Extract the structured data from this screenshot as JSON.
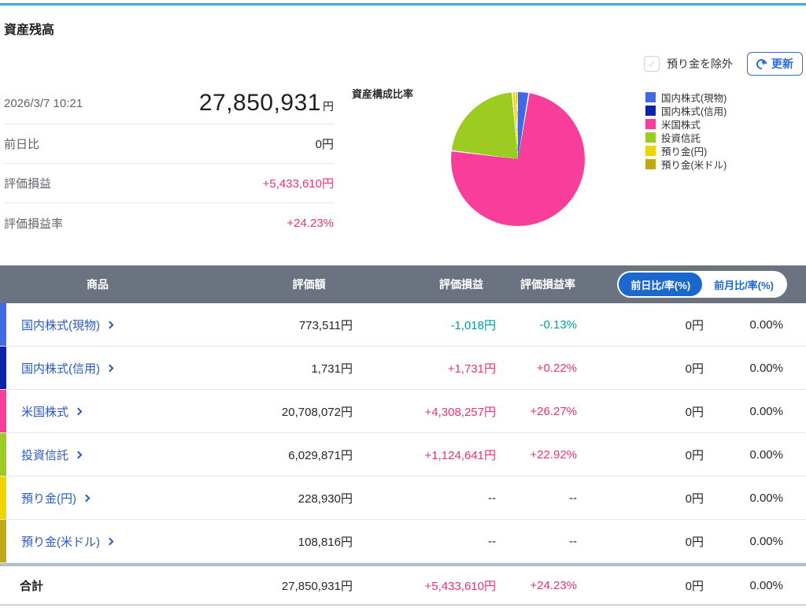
{
  "header": {
    "title": "資産残高"
  },
  "controls": {
    "checkbox_label": "預り金を除外",
    "checkbox_checked": false,
    "refresh_label": "更新"
  },
  "summary": {
    "timestamp": "2026/3/7 10:21",
    "total_value": "27,850,931",
    "total_unit": "円",
    "rows": [
      {
        "label": "前日比",
        "value": "0円"
      },
      {
        "label": "評価損益",
        "value": "+5,433,610円"
      },
      {
        "label": "評価損益率",
        "value": "+24.23%"
      }
    ]
  },
  "chart_data": {
    "type": "pie",
    "title": "資産構成比率",
    "legend_position": "right",
    "series": [
      {
        "label": "国内株式(現物)",
        "color": "#4169e1",
        "value_yen": 773511,
        "pct": 2.78
      },
      {
        "label": "国内株式(信用)",
        "color": "#0b23a8",
        "value_yen": 1731,
        "pct": 0.01
      },
      {
        "label": "米国株式",
        "color": "#f93d9b",
        "value_yen": 20708072,
        "pct": 74.35
      },
      {
        "label": "投資信託",
        "color": "#9ccc22",
        "value_yen": 6029871,
        "pct": 21.65
      },
      {
        "label": "預り金(円)",
        "color": "#eed400",
        "value_yen": 228930,
        "pct": 0.82
      },
      {
        "label": "預り金(米ドル)",
        "color": "#c0aa14",
        "value_yen": 108816,
        "pct": 0.39
      }
    ]
  },
  "table": {
    "columns": [
      "商品",
      "評価額",
      "評価損益",
      "評価損益率",
      "前日比/率(%)",
      "前月比/率(%)"
    ],
    "toggle": {
      "active": "前日比/率(%)",
      "inactive": "前月比/率(%)"
    },
    "rows": [
      {
        "product": "国内株式(現物)",
        "stripe": "#4169e1",
        "valuation": "773,511円",
        "pl": "-1,018円",
        "pl_rate": "-0.13%",
        "day_change": "0円",
        "day_rate": "0.00%"
      },
      {
        "product": "国内株式(信用)",
        "stripe": "#0b23a8",
        "valuation": "1,731円",
        "pl": "+1,731円",
        "pl_rate": "+0.22%",
        "day_change": "0円",
        "day_rate": "0.00%"
      },
      {
        "product": "米国株式",
        "stripe": "#f93d9b",
        "valuation": "20,708,072円",
        "pl": "+4,308,257円",
        "pl_rate": "+26.27%",
        "day_change": "0円",
        "day_rate": "0.00%"
      },
      {
        "product": "投資信託",
        "stripe": "#9ccc22",
        "valuation": "6,029,871円",
        "pl": "+1,124,641円",
        "pl_rate": "+22.92%",
        "day_change": "0円",
        "day_rate": "0.00%"
      },
      {
        "product": "預り金(円)",
        "stripe": "#eed400",
        "valuation": "228,930円",
        "pl": "--",
        "pl_rate": "--",
        "day_change": "0円",
        "day_rate": "0.00%"
      },
      {
        "product": "預り金(米ドル)",
        "stripe": "#c0aa14",
        "valuation": "108,816円",
        "pl": "--",
        "pl_rate": "--",
        "day_change": "0円",
        "day_rate": "0.00%"
      }
    ],
    "total": {
      "label": "合計",
      "valuation": "27,850,931円",
      "pl": "+5,433,610円",
      "pl_rate": "+24.23%",
      "day_change": "0円",
      "day_rate": "0.00%"
    }
  },
  "colors": {
    "accent_line": "#41a6ee",
    "header_bg": "#6b7280",
    "link_blue": "#2b59c3",
    "toggle_blue": "#1a67cd",
    "positive_pink": "#ea336f",
    "negative_teal": "#00a09a"
  }
}
